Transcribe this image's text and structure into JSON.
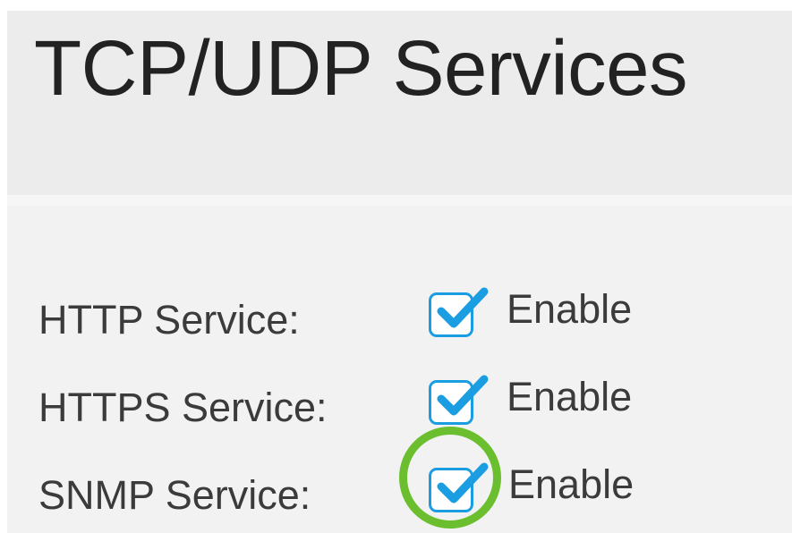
{
  "page": {
    "title": "TCP/UDP Services"
  },
  "services": [
    {
      "label": "HTTP Service:",
      "option_label": "Enable",
      "checked": true
    },
    {
      "label": "HTTPS Service:",
      "option_label": "Enable",
      "checked": true
    },
    {
      "label": "SNMP Service:",
      "option_label": "Enable",
      "checked": true,
      "highlighted": true
    }
  ],
  "colors": {
    "checkbox_border": "#1b9de2",
    "checkmark": "#1b9de2",
    "highlight_ring": "#6bbf2e",
    "header_background": "#ececec",
    "panel_background": "#f2f2f2"
  },
  "icons": {
    "checkbox": "checkmark-icon",
    "highlight": "highlight-circle"
  }
}
